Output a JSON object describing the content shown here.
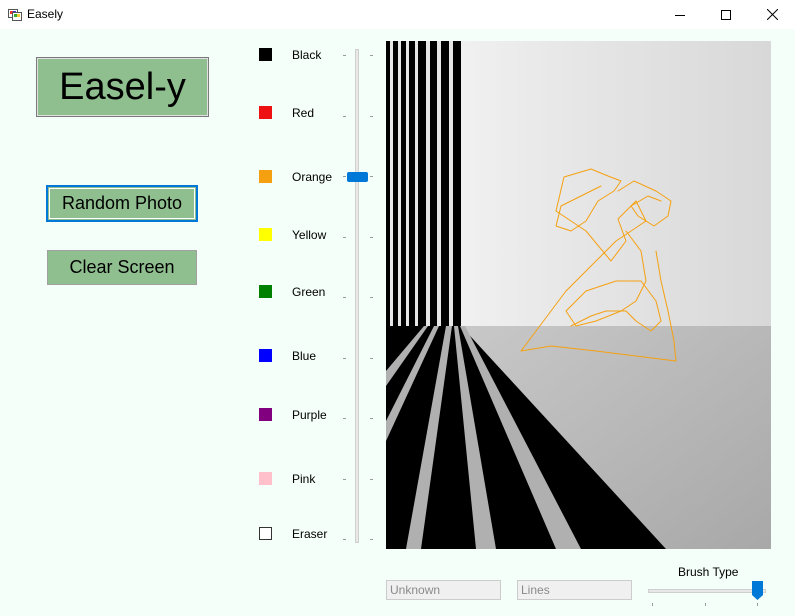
{
  "window": {
    "title": "Easely",
    "minimize_icon": "minimize-icon",
    "maximize_icon": "maximize-icon",
    "close_icon": "close-icon"
  },
  "left_panel": {
    "logo_button": "Easel-y",
    "random_photo_button": "Random Photo",
    "clear_screen_button": "Clear Screen"
  },
  "palette": {
    "colors": [
      {
        "label": "Black",
        "hex": "#000000"
      },
      {
        "label": "Red",
        "hex": "#ee1111"
      },
      {
        "label": "Orange",
        "hex": "#f5a011"
      },
      {
        "label": "Yellow",
        "hex": "#ffff00"
      },
      {
        "label": "Green",
        "hex": "#008000"
      },
      {
        "label": "Blue",
        "hex": "#0000ff"
      },
      {
        "label": "Purple",
        "hex": "#800080"
      },
      {
        "label": "Pink",
        "hex": "#ffc0cb"
      },
      {
        "label": "Eraser",
        "hex": "#ffffff"
      }
    ],
    "selected": "Orange"
  },
  "brush_size_slider": {
    "value_fraction": 0.26
  },
  "canvas": {
    "stroke_color": "#f5a011"
  },
  "bottom": {
    "photo_field_value": "Unknown",
    "brush_field_value": "Lines",
    "brush_type_label": "Brush Type",
    "brush_type_value_fraction": 1.0
  },
  "theme": {
    "button_green": "#8fbf8f",
    "accent": "#0078d7",
    "background": "#f5fff9"
  }
}
